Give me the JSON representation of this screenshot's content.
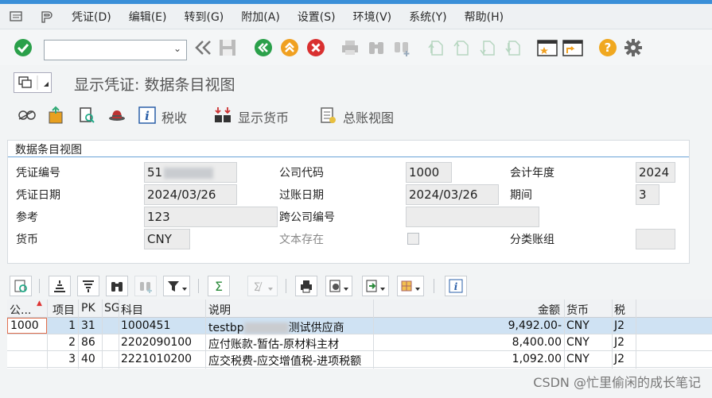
{
  "menu": {
    "items": [
      "凭证(D)",
      "编辑(E)",
      "转到(G)",
      "附加(A)",
      "设置(S)",
      "环境(V)",
      "系统(Y)",
      "帮助(H)"
    ]
  },
  "toolbar": {
    "command_value": "",
    "icons": [
      "enter-icon",
      "back-nav-icon",
      "save-icon",
      "back-icon",
      "exit-icon",
      "cancel-icon",
      "print-icon",
      "find-icon",
      "find-next-icon",
      "first-page-icon",
      "prev-page-icon",
      "next-page-icon",
      "last-page-icon",
      "new-session-icon",
      "shortcut-icon",
      "help-icon",
      "customize-icon"
    ]
  },
  "title": "显示凭证: 数据条目视图",
  "app_toolbar": {
    "tax_label": "税收",
    "currency_label": "显示货币",
    "gl_view_label": "总账视图"
  },
  "group": {
    "title": "数据条目视图",
    "labels": {
      "doc_no": "凭证编号",
      "company_code": "公司代码",
      "fiscal_year": "会计年度",
      "doc_date": "凭证日期",
      "posting_date": "过账日期",
      "period": "期间",
      "reference": "参考",
      "cross_cc": "跨公司编号",
      "currency": "货币",
      "text_exists": "文本存在",
      "ledger_group": "分类账组"
    },
    "values": {
      "doc_no": "51",
      "company_code": "1000",
      "fiscal_year": "2024",
      "doc_date": "2024/03/26",
      "posting_date": "2024/03/26",
      "period": "3",
      "reference": "123",
      "cross_cc": "",
      "currency": "CNY",
      "ledger_group": ""
    }
  },
  "grid": {
    "headers": {
      "cocode": "公...",
      "item": "项目",
      "pk": "PK",
      "sg": "SG",
      "account": "科目",
      "desc": "说明",
      "amount": "金额",
      "currency": "货币",
      "tax": "税"
    },
    "rows": [
      {
        "cocode": "1000",
        "item": "1",
        "pk": "31",
        "sg": "",
        "account": "1000451",
        "desc_pre": "testbp",
        "desc_post": "测试供应商",
        "amount": "9,492.00-",
        "currency": "CNY",
        "tax": "J2"
      },
      {
        "cocode": "",
        "item": "2",
        "pk": "86",
        "sg": "",
        "account": "2202090100",
        "desc": "应付账款-暂估-原材料主材",
        "amount": "8,400.00",
        "currency": "CNY",
        "tax": "J2"
      },
      {
        "cocode": "",
        "item": "3",
        "pk": "40",
        "sg": "",
        "account": "2221010200",
        "desc": "应交税费-应交增值税-进项税额",
        "amount": "1,092.00",
        "currency": "CNY",
        "tax": "J2"
      }
    ]
  },
  "colors": {
    "accent": "#3a8fd8",
    "green": "#2aa04a",
    "orange": "#f0a020",
    "red": "#d93030",
    "selected_row": "#cfe2f3"
  },
  "watermark": "CSDN @忙里偷闲的成长笔记"
}
